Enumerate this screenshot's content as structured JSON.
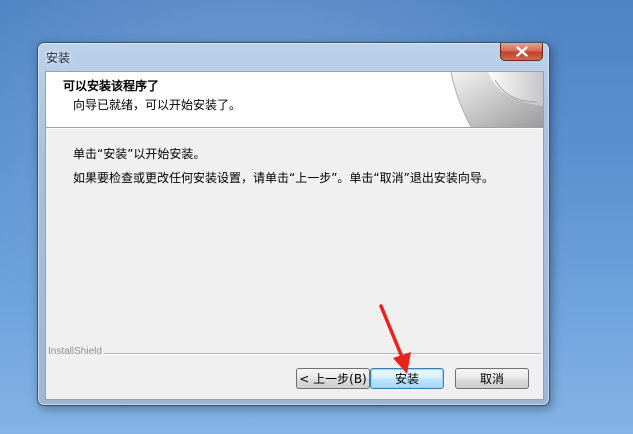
{
  "window": {
    "title": "安装"
  },
  "header": {
    "title": "可以安装该程序了",
    "subtitle": "向导已就绪，可以开始安装了。"
  },
  "body": {
    "line1": "单击“安装”以开始安装。",
    "line2": "如果要检查或更改任何安装设置，请单击“上一步”。单击“取消”退出安装向导。"
  },
  "brand": "InstallShield",
  "buttons": {
    "back": "< 上一步(B)",
    "install": "安装",
    "cancel": "取消"
  },
  "colors": {
    "accent_arrow": "#e8231d",
    "titlebar": "#a9c1dd",
    "close_button": "#c9533a"
  },
  "icons": [
    "close-icon",
    "wizard-page-curl-art",
    "pointer-arrow-annotation"
  ]
}
